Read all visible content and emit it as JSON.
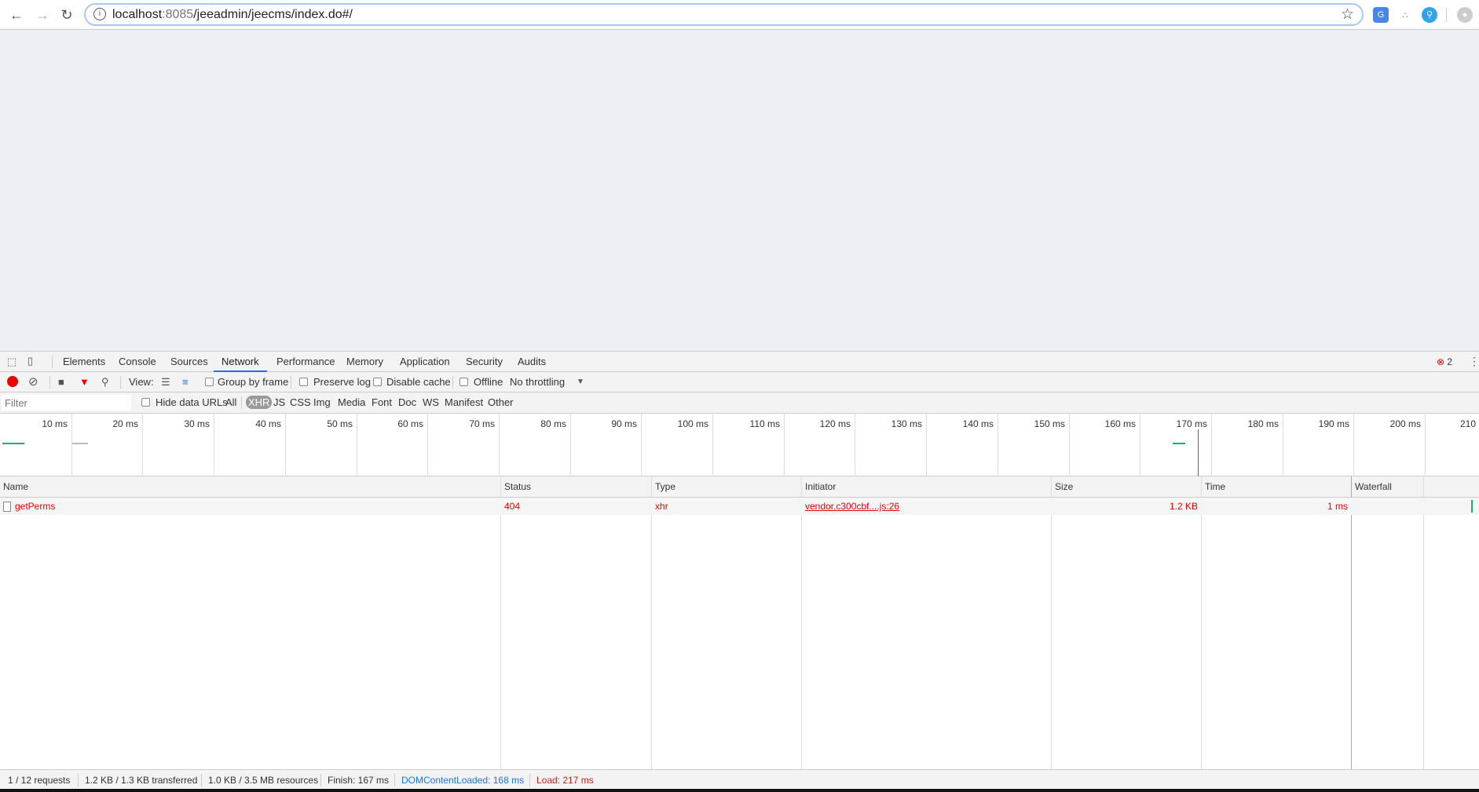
{
  "browser": {
    "url_host": "localhost",
    "url_port": ":8085",
    "url_path": "/jeeadmin/jeecms/index.do#/"
  },
  "devtools": {
    "tabs": [
      "Elements",
      "Console",
      "Sources",
      "Network",
      "Performance",
      "Memory",
      "Application",
      "Security",
      "Audits"
    ],
    "active_tab": "Network",
    "error_count": "2",
    "toolbar": {
      "view_label": "View:",
      "group_by_frame": "Group by frame",
      "preserve_log": "Preserve log",
      "disable_cache": "Disable cache",
      "offline": "Offline",
      "throttling": "No throttling"
    },
    "filter": {
      "placeholder": "Filter",
      "hide_data_urls": "Hide data URLs",
      "types": [
        "All",
        "XHR",
        "JS",
        "CSS",
        "Img",
        "Media",
        "Font",
        "Doc",
        "WS",
        "Manifest",
        "Other"
      ],
      "active_type": "XHR"
    },
    "timeline_ticks": [
      "10 ms",
      "20 ms",
      "30 ms",
      "40 ms",
      "50 ms",
      "60 ms",
      "70 ms",
      "80 ms",
      "90 ms",
      "100 ms",
      "110 ms",
      "120 ms",
      "130 ms",
      "140 ms",
      "150 ms",
      "160 ms",
      "170 ms",
      "180 ms",
      "190 ms",
      "200 ms",
      "210"
    ],
    "columns": [
      "Name",
      "Status",
      "Type",
      "Initiator",
      "Size",
      "Time",
      "Waterfall"
    ],
    "rows": [
      {
        "name": "getPerms",
        "status": "404",
        "type": "xhr",
        "initiator": "vendor.c300cbf....js:26",
        "size": "1.2 KB",
        "time": "1 ms"
      }
    ],
    "status_bar": {
      "requests": "1 / 12 requests",
      "transferred": "1.2 KB / 1.3 KB transferred",
      "resources": "1.0 KB / 3.5 MB resources",
      "finish": "Finish: 167 ms",
      "dcl": "DOMContentLoaded: 168 ms",
      "load": "Load: 217 ms"
    }
  },
  "colors": {
    "error": "#e00000",
    "dcl": "#1a73e8",
    "load": "#c5221f"
  }
}
